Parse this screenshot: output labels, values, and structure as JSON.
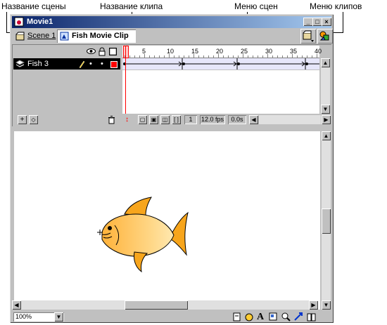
{
  "callouts": {
    "scene_name": "Название сцены",
    "clip_name": "Название клипа",
    "scene_menu": "Меню сцен",
    "clip_menu": "Меню клипов"
  },
  "window": {
    "title": "Movie1"
  },
  "tabs": [
    {
      "label": "Scene 1",
      "icon": "scene-icon"
    },
    {
      "label": "Fish Movie Clip",
      "icon": "movie-clip-icon"
    }
  ],
  "timeline": {
    "header_icons": [
      "eye-icon",
      "lock-icon",
      "outline-icon"
    ],
    "layer": {
      "name": "Fish 3",
      "icon": "layer-icon",
      "edit_icon": "pencil-icon",
      "color": "#ff0000"
    },
    "ruler_ticks": [
      "5",
      "10",
      "15",
      "20",
      "25",
      "30",
      "35",
      "40"
    ],
    "current_frame": "1",
    "fps": "12.0 fps",
    "elapsed": "0.0s"
  },
  "stage": {
    "zoom": "100%"
  },
  "colors": {
    "titlebar_start": "#0a246a",
    "titlebar_end": "#a6caf0",
    "fish": "#f7a51c",
    "playhead": "#ff0000"
  }
}
